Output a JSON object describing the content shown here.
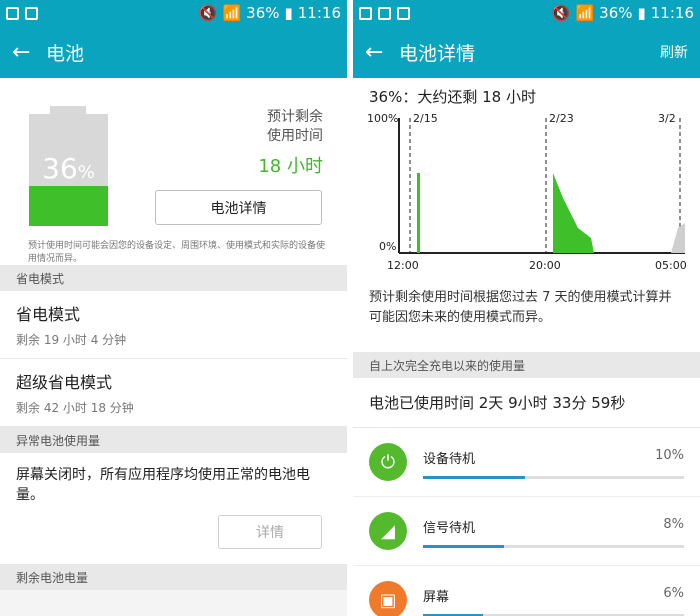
{
  "status_bar": {
    "battery": "36%",
    "time": "11:16"
  },
  "left": {
    "title": "电池",
    "battery_level": 0.36,
    "battery_pct_num": "36",
    "battery_pct_sign": "%",
    "est_label_1": "预计剩余",
    "est_label_2": "使用时间",
    "est_value": "18 小时",
    "detail_button": "电池详情",
    "note": "预计使用时间可能会因您的设备设定、周围环境、使用模式和实际的设备使用情况而异。",
    "power_saving_header": "省电模式",
    "power_saving": {
      "title": "省电模式",
      "sub": "剩余 19 小时 4 分钟"
    },
    "ultra_saving": {
      "title": "超级省电模式",
      "sub": "剩余 42 小时 18 分钟"
    },
    "abnormal_header": "异常电池使用量",
    "abnormal_text": "屏幕关闭时，所有应用程序均使用正常的电池电量。",
    "abnormal_button": "详情",
    "remaining_header": "剩余电池电量"
  },
  "right": {
    "title": "电池详情",
    "refresh": "刷新",
    "status_line": "36%：大约还剩 18 小时",
    "description": "预计剩余使用时间根据您过去 7 天的使用模式计算并可能因您未来的使用模式而异。",
    "since_header": "自上次完全充电以来的使用量",
    "total_use": "电池已使用时间 2天 9小时 33分 59秒",
    "usage": [
      {
        "name": "设备待机",
        "pct": "10%",
        "level": 0.39,
        "icon": "power-icon",
        "color": "#55b92e"
      },
      {
        "name": "信号待机",
        "pct": "8%",
        "level": 0.31,
        "icon": "signal-icon",
        "color": "#55b92e"
      },
      {
        "name": "屏幕",
        "pct": "6%",
        "level": 0.23,
        "icon": "screen-icon",
        "color": "#ee7a2c"
      }
    ]
  },
  "chart_data": {
    "type": "area",
    "y_tick_labels": [
      "100%",
      "0%"
    ],
    "date_markers": [
      "2/15",
      "2/23",
      "3/2"
    ],
    "x_tick_labels": [
      "12:00",
      "20:00",
      "05:00"
    ],
    "grid": false,
    "series_color": "#3fbf2a"
  }
}
